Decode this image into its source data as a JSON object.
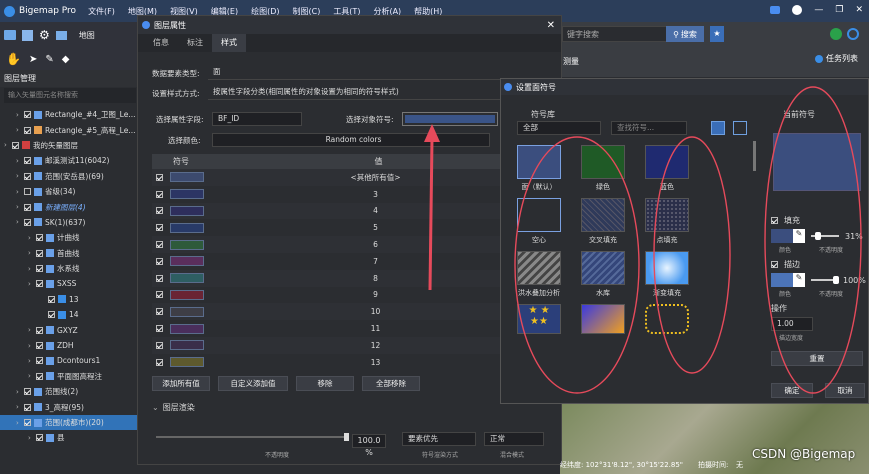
{
  "app": {
    "title": "Bigemap Pro",
    "menu": [
      "文件(F)",
      "地图(M)",
      "视图(V)",
      "编辑(E)",
      "绘图(D)",
      "制图(C)",
      "工具(T)",
      "分析(A)",
      "帮助(H)"
    ]
  },
  "toolbar": {
    "map_label": "地图"
  },
  "right_top": {
    "search_placeholder": "键字搜索",
    "search_btn": "搜索",
    "measure": "测量",
    "task_list": "任务列表"
  },
  "layer_mgr": {
    "title": "图层管理",
    "search_placeholder": "输入矢量图元名称搜索",
    "rows": [
      {
        "label": "Rectangle_#4_卫图_Le...",
        "indent": 1,
        "checked": true
      },
      {
        "label": "Rectangle_#5_高程_Le...",
        "indent": 1,
        "checked": true
      },
      {
        "label": "我的矢量图层",
        "indent": 0,
        "checked": true
      },
      {
        "label": "邮溪测试11(6042)",
        "indent": 1,
        "checked": true
      },
      {
        "label": "范围(安岳县)(69)",
        "indent": 1,
        "checked": true
      },
      {
        "label": "省级(34)",
        "indent": 1,
        "checked": false
      },
      {
        "label": "新建图层(4)",
        "indent": 1,
        "checked": true
      },
      {
        "label": "SK(1)(637)",
        "indent": 1,
        "checked": true
      },
      {
        "label": "计曲线",
        "indent": 2,
        "checked": true
      },
      {
        "label": "首曲线",
        "indent": 2,
        "checked": true
      },
      {
        "label": "水系线",
        "indent": 2,
        "checked": true
      },
      {
        "label": "SXSS",
        "indent": 2,
        "checked": true
      },
      {
        "label": "13",
        "indent": 3,
        "checked": true
      },
      {
        "label": "14",
        "indent": 3,
        "checked": true
      },
      {
        "label": "GXYZ",
        "indent": 2,
        "checked": true
      },
      {
        "label": "ZDH",
        "indent": 2,
        "checked": true
      },
      {
        "label": "Dcontours1",
        "indent": 2,
        "checked": true
      },
      {
        "label": "平面图高程注",
        "indent": 2,
        "checked": true
      },
      {
        "label": "范围线(2)",
        "indent": 1,
        "checked": true
      },
      {
        "label": "3_高程(95)",
        "indent": 1,
        "checked": true
      },
      {
        "label": "范围(成都市)(20)",
        "indent": 1,
        "checked": true
      },
      {
        "label": "县",
        "indent": 2,
        "checked": true
      }
    ]
  },
  "layer_props": {
    "title": "图层属性",
    "tabs": [
      "信息",
      "标注",
      "样式"
    ],
    "data_type_label": "数据要素类型:",
    "data_type_value": "面",
    "style_mode_label": "设置样式方式:",
    "style_mode_value": "按属性字段分类(相同属性的对象设置为相同的符号样式)",
    "field_label": "选择属性字段:",
    "field_value": "BF_ID",
    "symbol_label": "选择对象符号:",
    "color_label": "选择颜色:",
    "color_value": "Random colors",
    "col_symbol": "符号",
    "col_value": "值",
    "rows": [
      {
        "value": "<其他所有值>",
        "color": "#3c4a6e"
      },
      {
        "value": "3",
        "color": "#2c3564"
      },
      {
        "value": "4",
        "color": "#2e2e5c"
      },
      {
        "value": "5",
        "color": "#283a68"
      },
      {
        "value": "6",
        "color": "#2e5a3a"
      },
      {
        "value": "7",
        "color": "#5a2e5c"
      },
      {
        "value": "8",
        "color": "#2e5e62"
      },
      {
        "value": "9",
        "color": "#6a2434"
      },
      {
        "value": "10",
        "color": "#3e3e46"
      },
      {
        "value": "11",
        "color": "#4a2e5c"
      },
      {
        "value": "12",
        "color": "#3a2e4a"
      },
      {
        "value": "13",
        "color": "#5e5a2e"
      }
    ],
    "btn_add_all": "添加所有值",
    "btn_custom": "自定义添加值",
    "btn_remove": "移除",
    "btn_remove_all": "全部移除",
    "render_label": "图层渲染",
    "opacity": "100.0 %",
    "opacity_label": "不透明度",
    "render_mode": "要素优先",
    "render_mode_label": "符号渲染方式",
    "blend": "正常",
    "blend_label": "混合模式"
  },
  "symbol_dlg": {
    "title": "设置面符号",
    "lib_label": "符号库",
    "lib_value": "全部",
    "search_placeholder": "查找符号...",
    "current_label": "当前符号",
    "symbols": [
      {
        "name": "面（默认）",
        "color": "#3b4e7e"
      },
      {
        "name": "绿色",
        "color": "#1f5a26"
      },
      {
        "name": "蓝色",
        "color": "#1f2a70"
      },
      {
        "name": "空心",
        "color": "#2b2d31"
      },
      {
        "name": "交叉填充",
        "color": "#2f3a5a"
      },
      {
        "name": "点填充",
        "color": "#2b2f4a"
      },
      {
        "name": "洪水叠加分析",
        "color": "#555"
      },
      {
        "name": "水库",
        "color": "#34467a"
      },
      {
        "name": "渐变填充",
        "color": "#6fb8ff"
      }
    ],
    "fill_label": "填充",
    "fill_opacity": "31%",
    "fill_color_label": "颜色",
    "fill_op_label": "不透明度",
    "stroke_label": "描边",
    "stroke_opacity": "100%",
    "stroke_color_label": "颜色",
    "stroke_op_label": "不透明度",
    "op_label": "操作",
    "stroke_width": "1.00",
    "stroke_width_label": "描边宽度",
    "reset": "重置",
    "ok": "确定",
    "cancel": "取消"
  },
  "status": {
    "coords": "经纬度: 102°31'8.12\", 30°15'22.85\"",
    "time": "拍摄时间:",
    "time_value": "无",
    "watermark": "CSDN @Bigemap"
  }
}
